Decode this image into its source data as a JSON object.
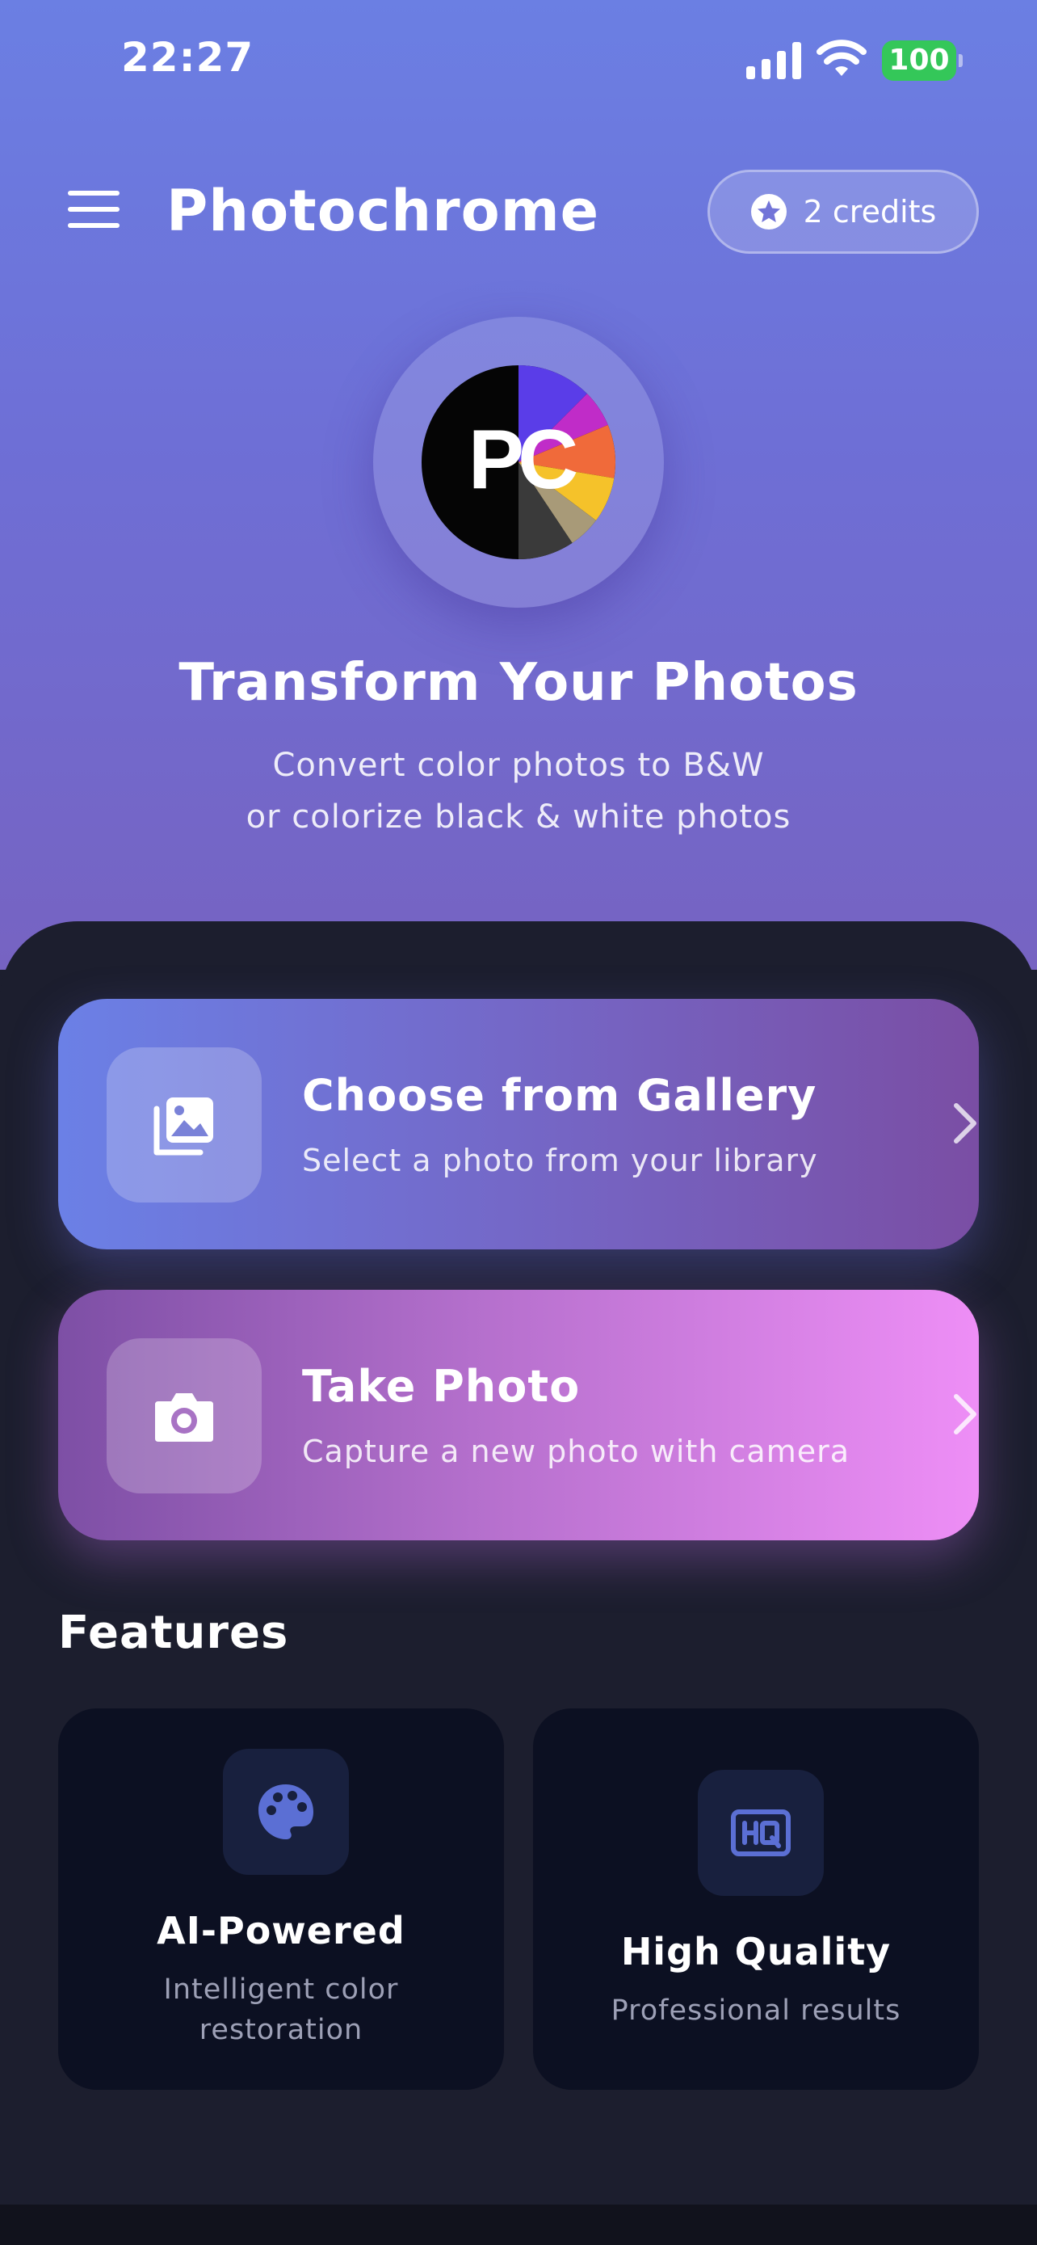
{
  "status_bar": {
    "time": "22:27",
    "battery_level": "100",
    "icons": [
      "cellular-signal-icon",
      "wifi-icon",
      "battery-icon"
    ]
  },
  "header": {
    "title": "Photochrome",
    "credits_label": "2 credits",
    "icons": [
      "hamburger-menu-icon",
      "star-badge-icon"
    ]
  },
  "hero": {
    "logo_text": "PC",
    "title": "Transform Your Photos",
    "subtitle_line1": "Convert color photos to B&W",
    "subtitle_line2": "or colorize black & white photos"
  },
  "actions": [
    {
      "title": "Choose from Gallery",
      "subtitle": "Select a photo from your library",
      "icon": "photo-library-icon"
    },
    {
      "title": "Take Photo",
      "subtitle": "Capture a new photo with camera",
      "icon": "camera-icon"
    }
  ],
  "features": {
    "heading": "Features",
    "items": [
      {
        "name": "AI-Powered",
        "desc_line1": "Intelligent color",
        "desc_line2": "restoration",
        "icon": "palette-icon"
      },
      {
        "name": "High Quality",
        "desc_line1": "Professional results",
        "icon": "hq-icon"
      }
    ]
  },
  "colors": {
    "hero_top": "#6b7fe3",
    "hero_bottom": "#7663c2",
    "sheet_background": "#1c1e2e",
    "feature_card": "#0c1022",
    "feature_icon_accent": "#5b6fd4",
    "battery_green": "#34c759"
  }
}
